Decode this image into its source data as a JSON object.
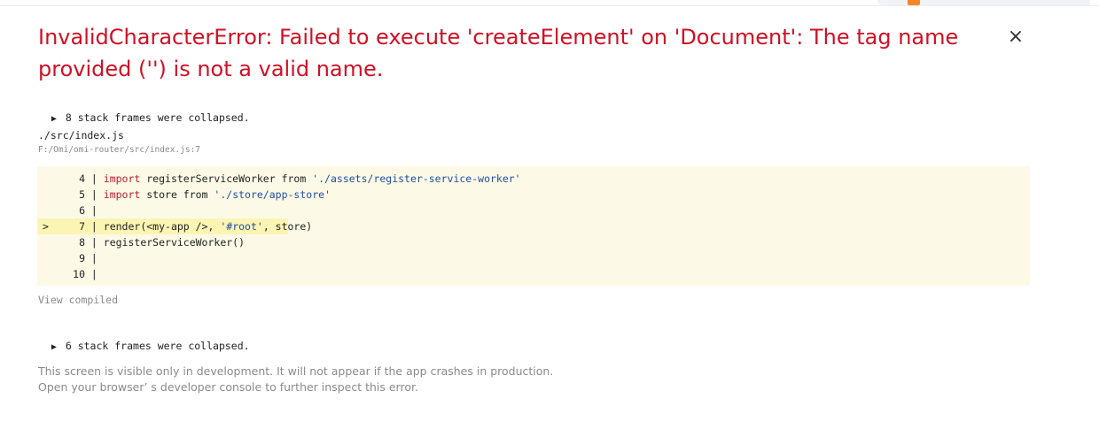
{
  "overlay": {
    "title": "InvalidCharacterError: Failed to execute 'createElement' on 'Document': The tag name provided ('') is not a valid name.",
    "close_label": "×"
  },
  "collapsed_top": {
    "icon": "triangle-right-icon",
    "label": "8 stack frames were collapsed."
  },
  "frame": {
    "path": "./src/index.js",
    "location": "F:/Omi/omi-router/src/index.js:7"
  },
  "code": {
    "highlighted_line": 7,
    "lines": [
      {
        "num": "4",
        "marker": "",
        "tokens": [
          {
            "t": "kw",
            "v": "import"
          },
          {
            "t": "plain",
            "v": " registerServiceWorker from "
          },
          {
            "t": "str",
            "v": "'./assets/register-service-worker'"
          }
        ]
      },
      {
        "num": "5",
        "marker": "",
        "tokens": [
          {
            "t": "kw",
            "v": "import"
          },
          {
            "t": "plain",
            "v": " store from "
          },
          {
            "t": "str",
            "v": "'./store/app-store'"
          }
        ]
      },
      {
        "num": "6",
        "marker": "",
        "tokens": []
      },
      {
        "num": "7",
        "marker": ">",
        "tokens": [
          {
            "t": "plain",
            "v": "render(<my-app />, "
          },
          {
            "t": "str",
            "v": "'#root'"
          },
          {
            "t": "plain",
            "v": ", store)"
          }
        ]
      },
      {
        "num": "8",
        "marker": "",
        "tokens": [
          {
            "t": "plain",
            "v": "registerServiceWorker()"
          }
        ]
      },
      {
        "num": "9",
        "marker": "",
        "tokens": []
      },
      {
        "num": "10",
        "marker": "",
        "tokens": []
      }
    ]
  },
  "view_compiled_label": "View compiled",
  "collapsed_bottom": {
    "icon": "triangle-right-icon",
    "label": "6 stack frames were collapsed."
  },
  "footer": {
    "line1": "This screen is visible only in development. It will not appear if the app crashes in production.",
    "line2": "Open your browser’ s developer console to further inspect this error."
  },
  "colors": {
    "error_red": "#ce1126",
    "code_bg": "#fcfae6",
    "highlight_bg": "#fbf5b4",
    "keyword": "#bb1b2f",
    "string": "#1f4ea5",
    "muted": "#8a8a8a"
  }
}
